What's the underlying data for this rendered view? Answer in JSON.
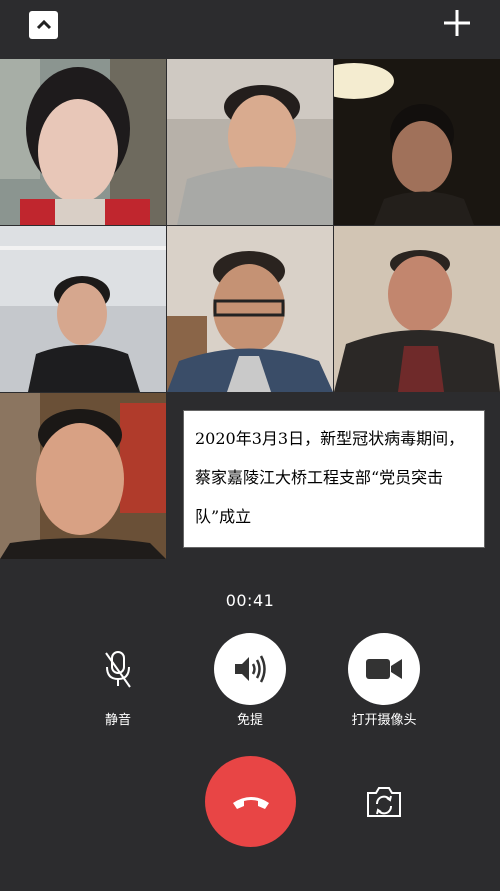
{
  "header": {
    "collapse_icon": "chevron-up-icon",
    "add_icon": "plus-icon"
  },
  "participants": [
    {
      "name": "participant-1"
    },
    {
      "name": "participant-2"
    },
    {
      "name": "participant-3"
    },
    {
      "name": "participant-4"
    },
    {
      "name": "participant-5"
    },
    {
      "name": "participant-6"
    },
    {
      "name": "participant-7"
    }
  ],
  "notice": {
    "line1": "2020年3月3日，新型冠状病毒期间，",
    "line2": "蔡家嘉陵江大桥工程支部“党员突击",
    "line3": "队”成立"
  },
  "call": {
    "timer": "00:41",
    "mute_label": "静音",
    "speaker_label": "免提",
    "camera_label": "打开摄像头"
  },
  "colors": {
    "background": "#2c2c2e",
    "hangup": "#e84545"
  }
}
